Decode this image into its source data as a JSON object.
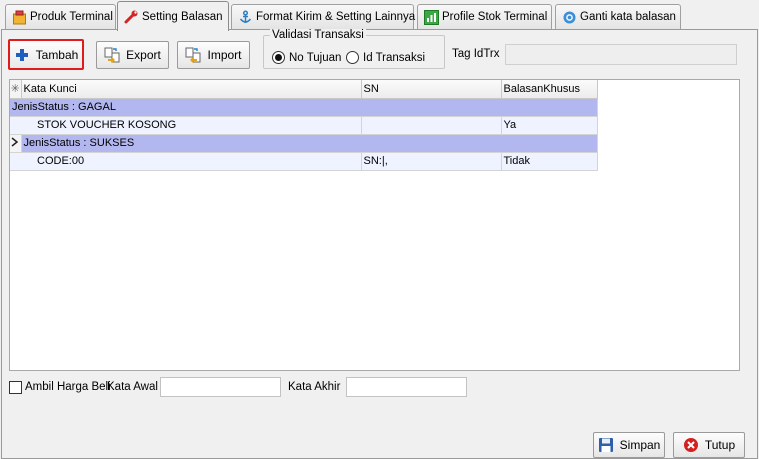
{
  "tabs": [
    {
      "label": "Produk Terminal",
      "icon": "box-icon"
    },
    {
      "label": "Setting Balasan",
      "icon": "wrench-icon",
      "active": true
    },
    {
      "label": "Format Kirim & Setting Lainnya",
      "icon": "anchor-icon"
    },
    {
      "label": "Profile Stok Terminal",
      "icon": "chart-icon"
    },
    {
      "label": "Ganti kata balasan",
      "icon": "ring-icon"
    }
  ],
  "toolbar": {
    "tambah_label": "Tambah",
    "export_label": "Export",
    "import_label": "Import"
  },
  "validasi": {
    "title": "Validasi Transaksi",
    "opt1": "No Tujuan",
    "opt2": "Id Transaksi",
    "selected": "No Tujuan"
  },
  "tag": {
    "label": "Tag IdTrx",
    "value": ""
  },
  "grid": {
    "columns": [
      "Kata Kunci",
      "SN",
      "BalasanKhusus"
    ],
    "groups": [
      {
        "label": "JenisStatus : GAGAL",
        "rows": [
          {
            "kata": "STOK VOUCHER KOSONG",
            "sn": "",
            "balasan": "Ya"
          }
        ]
      },
      {
        "label": "JenisStatus : SUKSES",
        "rows": [
          {
            "kata": "CODE:00",
            "sn": "SN:|,",
            "balasan": "Tidak"
          }
        ]
      }
    ]
  },
  "filter": {
    "ambil_label": "Ambil Harga Beli",
    "ambil_checked": false,
    "awal_label": "Kata Awal",
    "awal_value": "",
    "akhir_label": "Kata Akhir",
    "akhir_value": ""
  },
  "footer": {
    "simpan_label": "Simpan",
    "tutup_label": "Tutup"
  },
  "colors": {
    "group_row": "#b3b7ef",
    "data_row": "#eef3ff",
    "highlight": "#e01b1b"
  }
}
